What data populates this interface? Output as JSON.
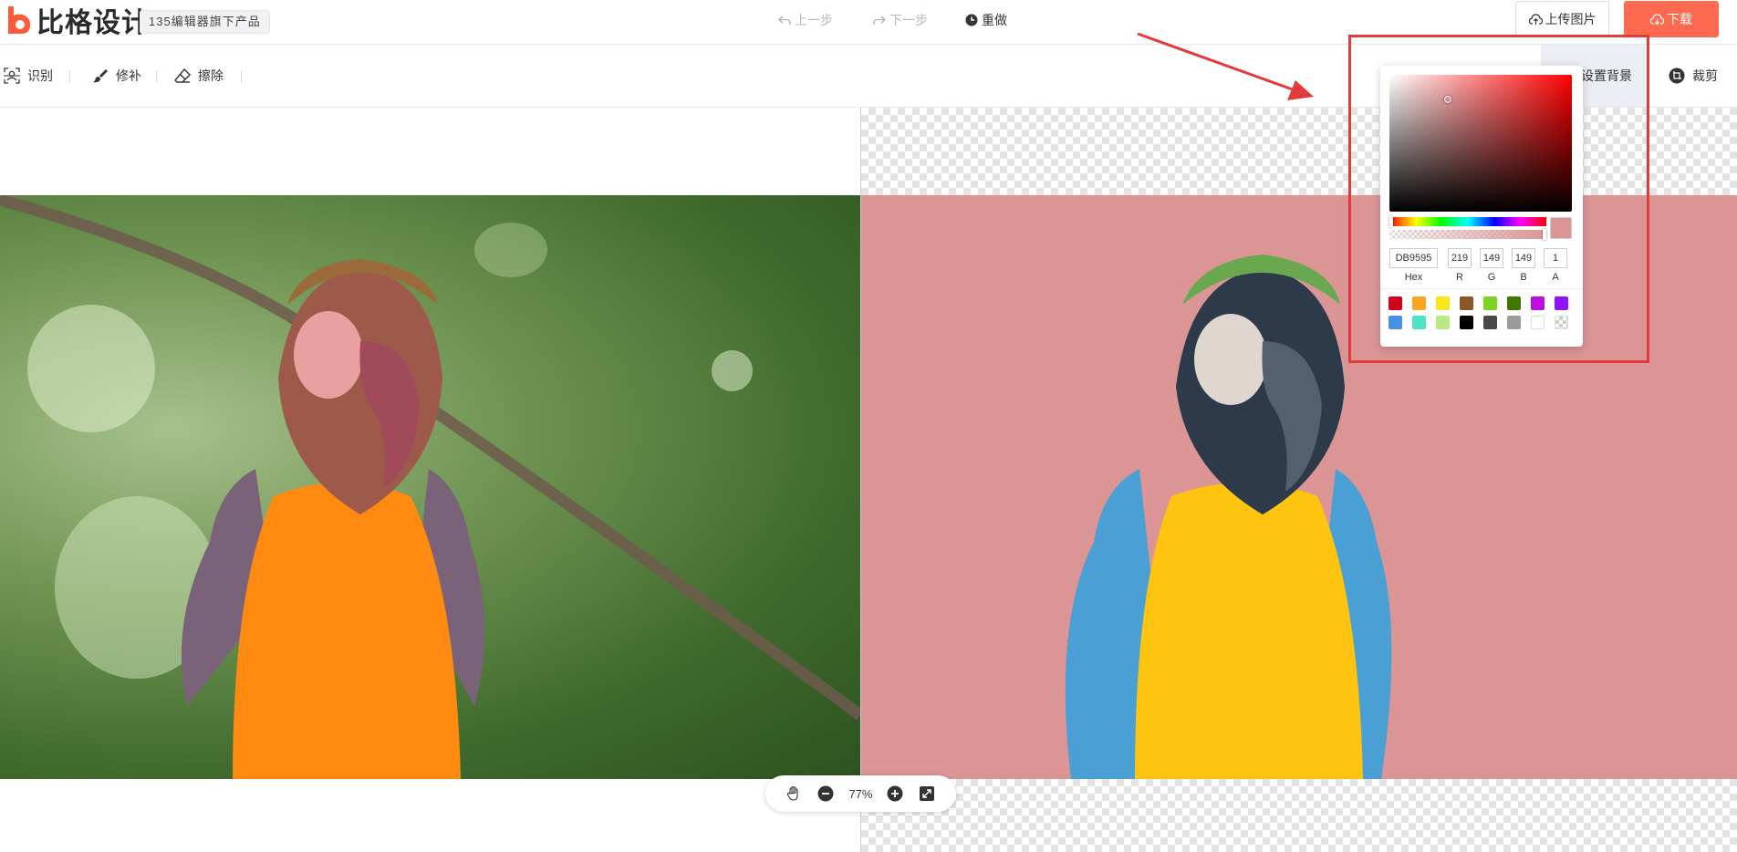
{
  "header": {
    "logo_text": "比格设计",
    "product_tag": "135编辑器旗下产品",
    "undo_label": "上一步",
    "redo_label": "下一步",
    "redo_again_label": "重做",
    "upload_label": "上传图片",
    "download_label": "下载"
  },
  "toolbar": {
    "identify_label": "识别",
    "repair_label": "修补",
    "erase_label": "擦除",
    "set_background_label": "设置背景",
    "crop_label": "裁剪"
  },
  "zoom": {
    "value_label": "77%"
  },
  "color_picker": {
    "hex_value": "DB9595",
    "r_value": "219",
    "g_value": "149",
    "b_value": "149",
    "a_value": "1",
    "hex_label": "Hex",
    "r_label": "R",
    "g_label": "G",
    "b_label": "B",
    "a_label": "A",
    "current_color": "#db9595",
    "hue_color": "#ff0000",
    "swatches": [
      "#d0021b",
      "#f5a623",
      "#f8e71c",
      "#8b572a",
      "#7ed321",
      "#417505",
      "#bd10e0",
      "#9013fe",
      "#4a90e2",
      "#50e3c2",
      "#b8e986",
      "#000000",
      "#4a4a4a",
      "#9b9b9b",
      "#ffffff",
      "transparent"
    ]
  },
  "colors": {
    "accent": "#fd6a4f",
    "highlight_border": "#e33b3b",
    "result_background": "#db9595"
  }
}
